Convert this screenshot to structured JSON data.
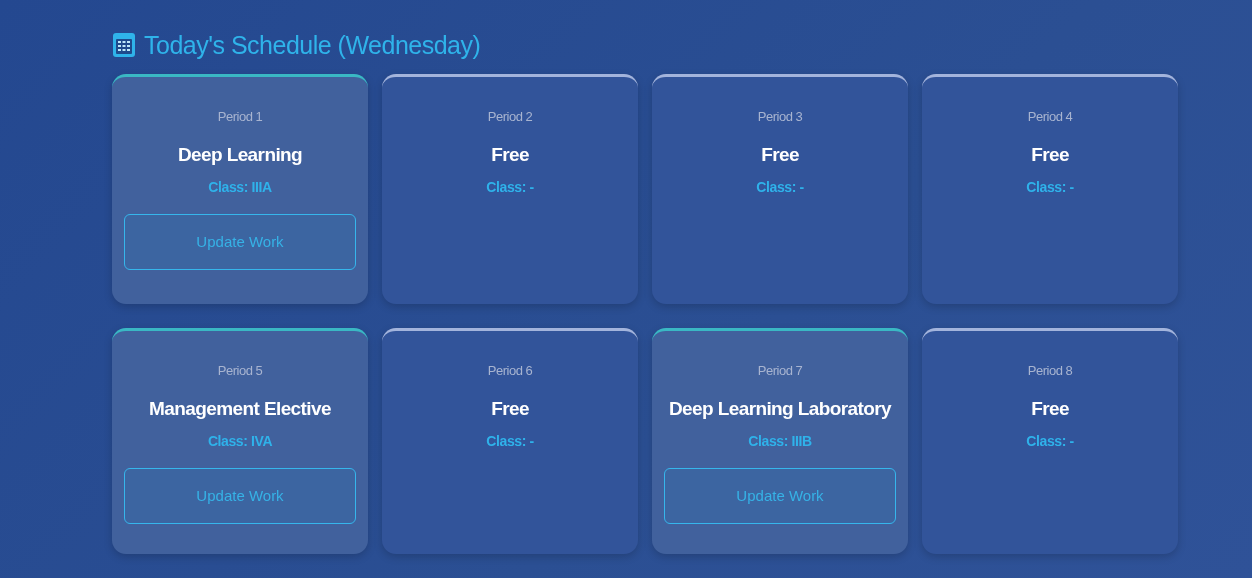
{
  "title": "Today's Schedule (Wednesday)",
  "periods": [
    {
      "kind": "class",
      "period": "Period 1",
      "subject": "Deep Learning",
      "class_label": "Class: IIIA",
      "button": "Update Work"
    },
    {
      "kind": "free",
      "period": "Period 2",
      "subject": "Free",
      "class_label": "Class: -"
    },
    {
      "kind": "free",
      "period": "Period 3",
      "subject": "Free",
      "class_label": "Class: -"
    },
    {
      "kind": "free",
      "period": "Period 4",
      "subject": "Free",
      "class_label": "Class: -"
    },
    {
      "kind": "class",
      "period": "Period 5",
      "subject": "Management Elective",
      "class_label": "Class: IVA",
      "button": "Update Work"
    },
    {
      "kind": "free",
      "period": "Period 6",
      "subject": "Free",
      "class_label": "Class: -"
    },
    {
      "kind": "class",
      "period": "Period 7",
      "subject": "Deep Learning Laboratory",
      "class_label": "Class: IIIB",
      "button": "Update Work"
    },
    {
      "kind": "free",
      "period": "Period 8",
      "subject": "Free",
      "class_label": "Class: -"
    }
  ]
}
